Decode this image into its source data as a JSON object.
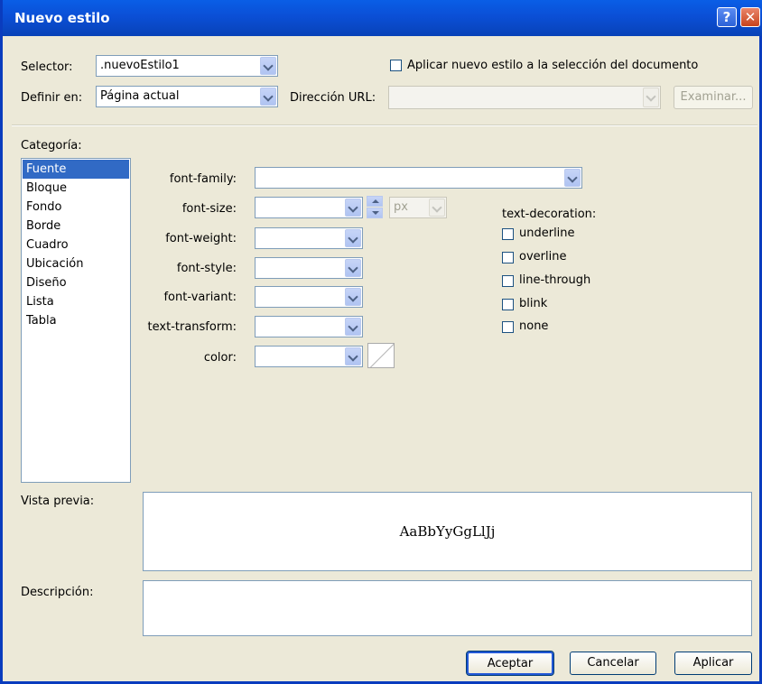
{
  "window": {
    "title": "Nuevo estilo",
    "help_glyph": "?",
    "close_glyph": "✕"
  },
  "selector": {
    "label": "Selector:",
    "value": ".nuevoEstilo1"
  },
  "apply_checkbox": {
    "label": "Aplicar nuevo estilo a la selección del documento",
    "checked": false
  },
  "define_in": {
    "label": "Definir en:",
    "value": "Página actual"
  },
  "url": {
    "label": "Dirección URL:",
    "value": ""
  },
  "browse_button": "Examinar...",
  "category": {
    "label": "Categoría:",
    "items": [
      "Fuente",
      "Bloque",
      "Fondo",
      "Borde",
      "Cuadro",
      "Ubicación",
      "Diseño",
      "Lista",
      "Tabla"
    ],
    "selected": "Fuente"
  },
  "properties": {
    "font_family": {
      "label": "font-family:",
      "value": ""
    },
    "font_size": {
      "label": "font-size:",
      "value": "",
      "unit": "px"
    },
    "font_weight": {
      "label": "font-weight:",
      "value": ""
    },
    "font_style": {
      "label": "font-style:",
      "value": ""
    },
    "font_variant": {
      "label": "font-variant:",
      "value": ""
    },
    "text_transform": {
      "label": "text-transform:",
      "value": ""
    },
    "color": {
      "label": "color:",
      "value": ""
    }
  },
  "text_decoration": {
    "label": "text-decoration:",
    "options": [
      "underline",
      "overline",
      "line-through",
      "blink",
      "none"
    ]
  },
  "preview": {
    "label": "Vista previa:",
    "sample": "AaBbYyGgLlJj"
  },
  "description": {
    "label": "Descripción:",
    "value": ""
  },
  "buttons": {
    "ok": "Aceptar",
    "cancel": "Cancelar",
    "apply": "Aplicar"
  },
  "colors": {
    "titlebar": "#0b4fd6",
    "selection": "#316ac5",
    "dialog_bg": "#ece9d8"
  }
}
